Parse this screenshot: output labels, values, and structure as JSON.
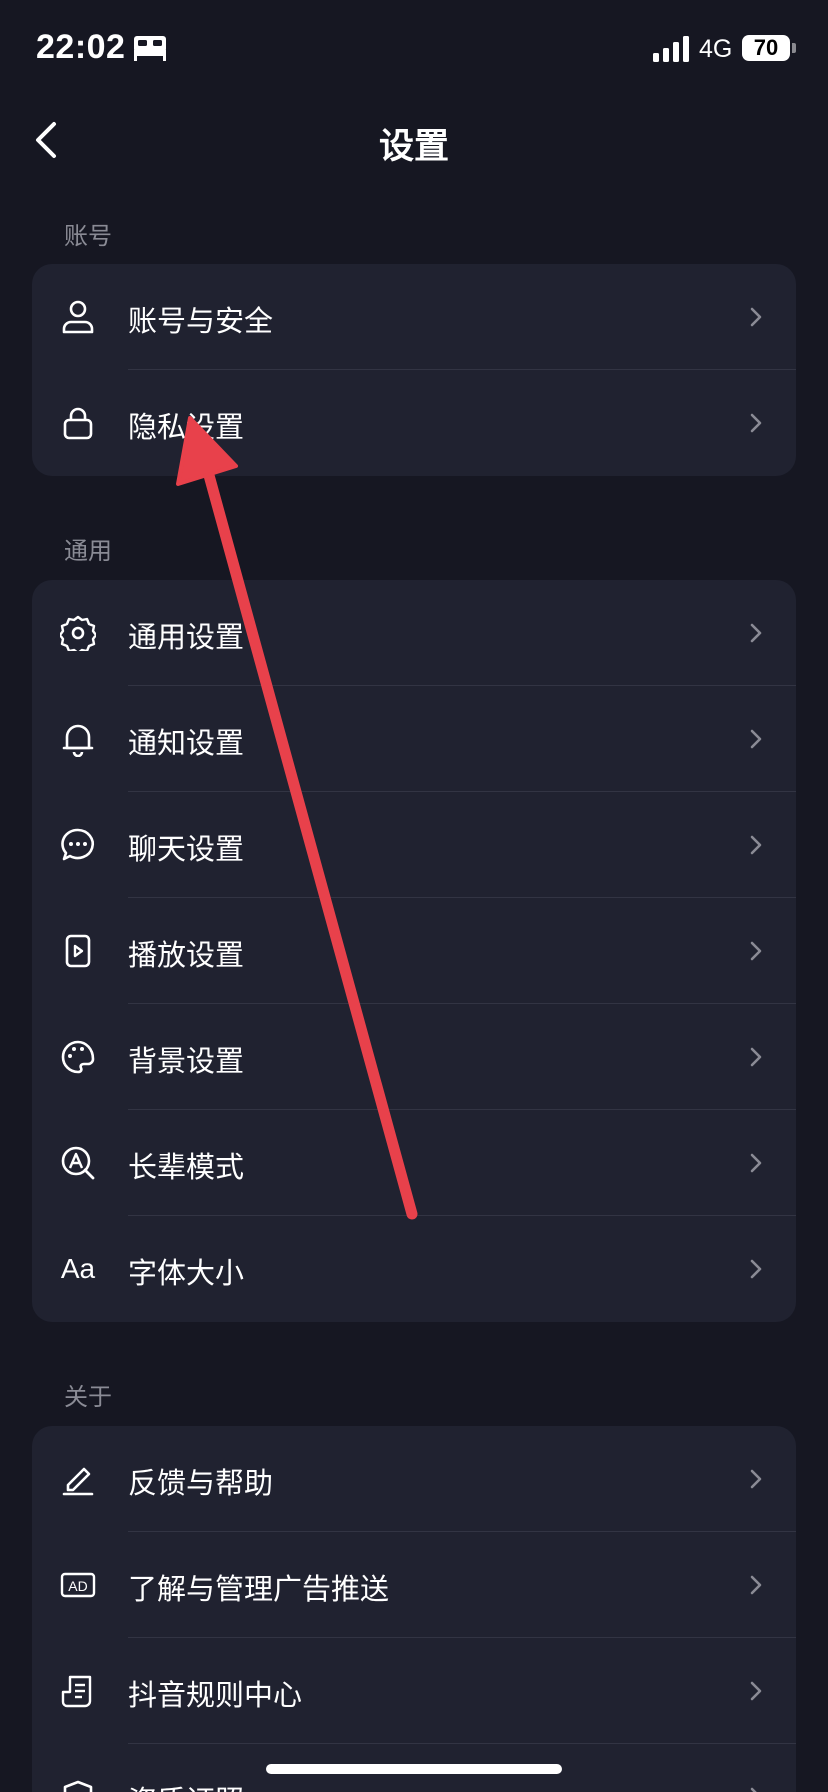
{
  "status_bar": {
    "time": "22:02",
    "mode_icon": "bed-icon",
    "network": "4G",
    "battery": "70"
  },
  "nav": {
    "title": "设置",
    "back_icon": "chevron-left-icon"
  },
  "sections": [
    {
      "header": "账号",
      "items": [
        {
          "label": "账号与安全",
          "icon": "user-icon"
        },
        {
          "label": "隐私设置",
          "icon": "lock-icon"
        }
      ]
    },
    {
      "header": "通用",
      "items": [
        {
          "label": "通用设置",
          "icon": "gear-icon"
        },
        {
          "label": "通知设置",
          "icon": "bell-icon"
        },
        {
          "label": "聊天设置",
          "icon": "chat-icon"
        },
        {
          "label": "播放设置",
          "icon": "play-icon"
        },
        {
          "label": "背景设置",
          "icon": "palette-icon"
        },
        {
          "label": "长辈模式",
          "icon": "elder-mode-icon"
        },
        {
          "label": "字体大小",
          "icon": "font-size-icon",
          "icon_text": "Aa"
        }
      ]
    },
    {
      "header": "关于",
      "items": [
        {
          "label": "反馈与帮助",
          "icon": "edit-icon"
        },
        {
          "label": "了解与管理广告推送",
          "icon": "ad-icon",
          "icon_text": "AD"
        },
        {
          "label": "抖音规则中心",
          "icon": "rules-icon"
        },
        {
          "label": "资质证照",
          "icon": "shield-icon"
        }
      ]
    }
  ],
  "colors": {
    "background": "#161722",
    "card": "#202230",
    "annotation_arrow": "#e8414b"
  }
}
